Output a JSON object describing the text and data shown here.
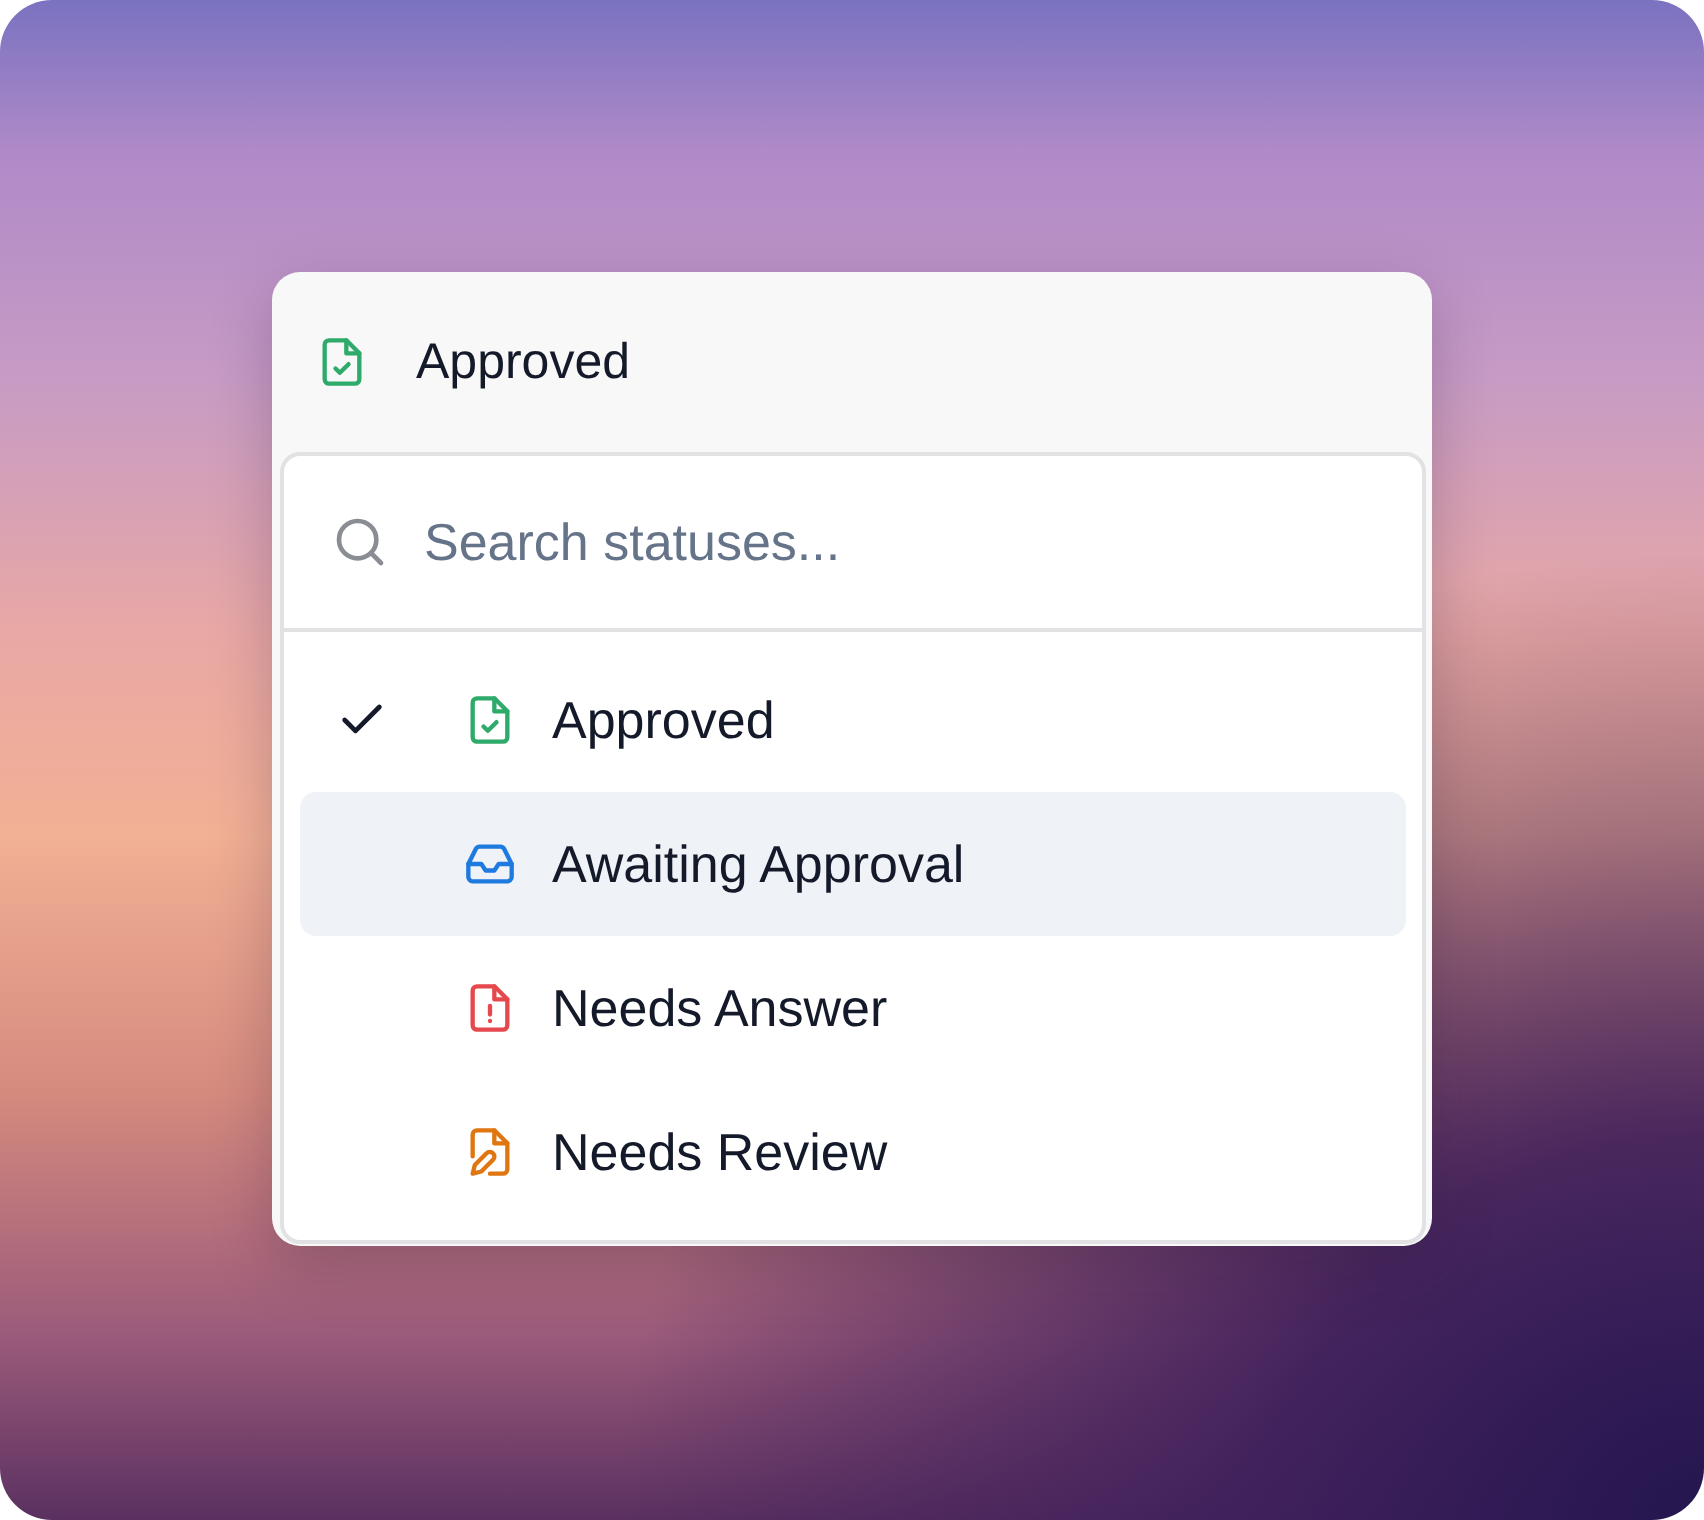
{
  "trigger": {
    "label": "Approved",
    "kind": "approved",
    "color": "#2eaa6a"
  },
  "search": {
    "placeholder": "Search statuses..."
  },
  "options": [
    {
      "label": "Approved",
      "kind": "approved",
      "color": "#2eaa6a",
      "selected": true,
      "highlighted": false
    },
    {
      "label": "Awaiting Approval",
      "kind": "awaiting",
      "color": "#1f7ae0",
      "selected": false,
      "highlighted": true
    },
    {
      "label": "Needs Answer",
      "kind": "answer",
      "color": "#e5484d",
      "selected": false,
      "highlighted": false
    },
    {
      "label": "Needs Review",
      "kind": "review",
      "color": "#e0760f",
      "selected": false,
      "highlighted": false
    }
  ]
}
